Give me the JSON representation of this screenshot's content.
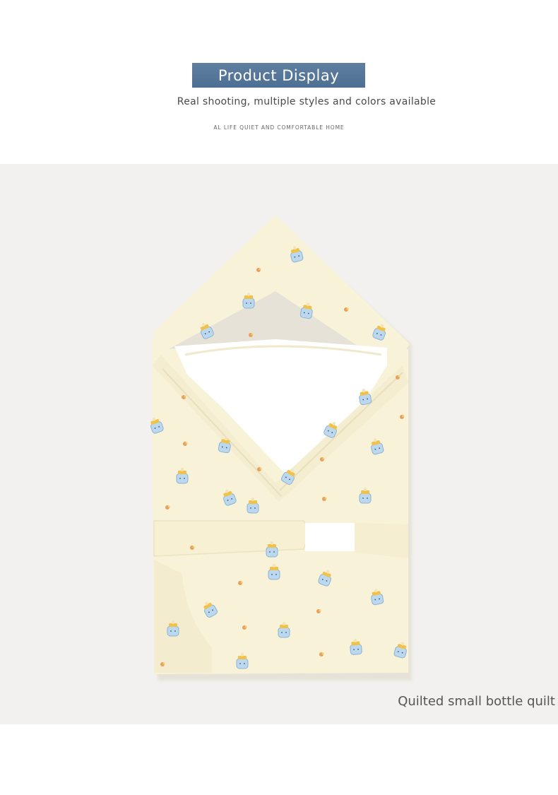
{
  "header": {
    "title": "Product Display",
    "subtitle": "Real shooting, multiple styles and colors available",
    "caption": "AL LIFE  QUIET AND COMFORTABLE HOME"
  },
  "product": {
    "caption": "Quilted small bottle quilt",
    "colors": {
      "section_bg": "#f2f1ef",
      "fabric": "#f8f2d8",
      "fabric_shadow": "#eee5c4",
      "lining": "#ffffff",
      "print_blue": "#9fc7e8",
      "print_yellow": "#f0c24a",
      "print_orange": "#e8a060"
    }
  }
}
